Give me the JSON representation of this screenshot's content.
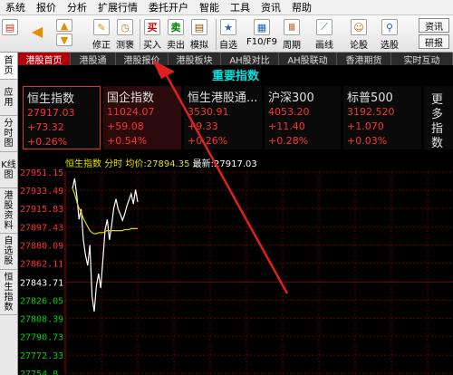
{
  "menu": [
    "系统",
    "报价",
    "分析",
    "扩展行情",
    "委托开户",
    "智能",
    "工具",
    "资讯",
    "帮助"
  ],
  "toolbar": {
    "buttons": [
      {
        "label": "修正",
        "icon": "wrench-icon",
        "glyph": "✎"
      },
      {
        "label": "测褒",
        "icon": "clock-icon",
        "glyph": "◷"
      },
      {
        "label": "买入",
        "icon": "buy-icon",
        "glyph": "买"
      },
      {
        "label": "卖出",
        "icon": "sell-icon",
        "glyph": "卖"
      },
      {
        "label": "模拟",
        "icon": "simulate-icon",
        "glyph": "▤"
      },
      {
        "label": "自选",
        "icon": "star-icon",
        "glyph": "★"
      },
      {
        "label": "F10/F9",
        "icon": "f10-icon",
        "glyph": "▦"
      },
      {
        "label": "周期",
        "icon": "period-icon",
        "glyph": "Ⅲ"
      },
      {
        "label": "画线",
        "icon": "draw-line-icon",
        "glyph": "⟋"
      },
      {
        "label": "论股",
        "icon": "chat-icon",
        "glyph": "☺"
      },
      {
        "label": "选股",
        "icon": "filter-icon",
        "glyph": "⚲"
      }
    ],
    "right_buttons": [
      "资讯",
      "研报"
    ]
  },
  "sidebar": [
    "首页",
    "应用",
    "分时图",
    "K线图",
    "港股资料",
    "自选股",
    "恒生指数"
  ],
  "tabs": [
    "港股首页",
    "港股通",
    "港股报价",
    "港股板块",
    "AH股对比",
    "AH股联动",
    "香港期货",
    "实时互动"
  ],
  "header": {
    "title": "重要指数"
  },
  "cards": [
    {
      "name": "恒生指数",
      "price": "27917.03",
      "change": "+73.32",
      "pct": "+0.26%"
    },
    {
      "name": "国企指数",
      "price": "11024.07",
      "change": "+59.08",
      "pct": "+0.54%"
    },
    {
      "name": "恒生港股通...",
      "price": "3530.91",
      "change": "+9.33",
      "pct": "+0.26%"
    },
    {
      "name": "沪深300",
      "price": "4053.20",
      "change": "+11.40",
      "pct": "+0.28%"
    },
    {
      "name": "标普500",
      "price": "3192.520",
      "change": "+1.070",
      "pct": "+0.03%"
    },
    {
      "name": "更多指数",
      "price": "",
      "change": "",
      "pct": ""
    }
  ],
  "legend": {
    "name": "恒生指数",
    "mode": "分时",
    "avg_label": "均价:",
    "avg": "27894.35",
    "last_label": "最新:",
    "last": "27917.03"
  },
  "chart_data": {
    "type": "line",
    "ylim": [
      27754.8,
      27951.15
    ],
    "yticks": [
      "27951.15",
      "27933.49",
      "27915.83",
      "27897.43",
      "27880.09",
      "27862.11",
      "27843.71",
      "27826.05",
      "27808.39",
      "27790.73",
      "27772.33",
      "27754.8"
    ],
    "series": [
      {
        "name": "恒生指数",
        "color": "#ffffff",
        "x": [
          0,
          1,
          2,
          3,
          4,
          5,
          6,
          7,
          8,
          9,
          10,
          11,
          12,
          13,
          14,
          15,
          16,
          17,
          18,
          19,
          20,
          21,
          22,
          23,
          24,
          25,
          26,
          27,
          28,
          29,
          30
        ],
        "y": [
          27935,
          27945,
          27928,
          27905,
          27915,
          27885,
          27870,
          27860,
          27880,
          27830,
          27815,
          27840,
          27852,
          27838,
          27866,
          27895,
          27905,
          27885,
          27899,
          27916,
          27925,
          27915,
          27910,
          27904,
          27910,
          27918,
          27924,
          27930,
          27920,
          27934,
          27922
        ]
      },
      {
        "name": "均价",
        "color": "#d8d800",
        "x": [
          0,
          1,
          2,
          3,
          4,
          5,
          6,
          7,
          8,
          9,
          10,
          11,
          12,
          13,
          14,
          15,
          16,
          17,
          18,
          19,
          20,
          21,
          22,
          23,
          24,
          25,
          26,
          27,
          28,
          29,
          30
        ],
        "y": [
          27935,
          27930,
          27922,
          27916,
          27912,
          27906,
          27902,
          27898,
          27894,
          27892,
          27891,
          27891,
          27892,
          27892,
          27892,
          27893,
          27894,
          27894,
          27894,
          27894,
          27894,
          27894,
          27894,
          27894,
          27895,
          27895,
          27895,
          27896,
          27896,
          27896,
          27896
        ]
      }
    ],
    "grid": true
  }
}
